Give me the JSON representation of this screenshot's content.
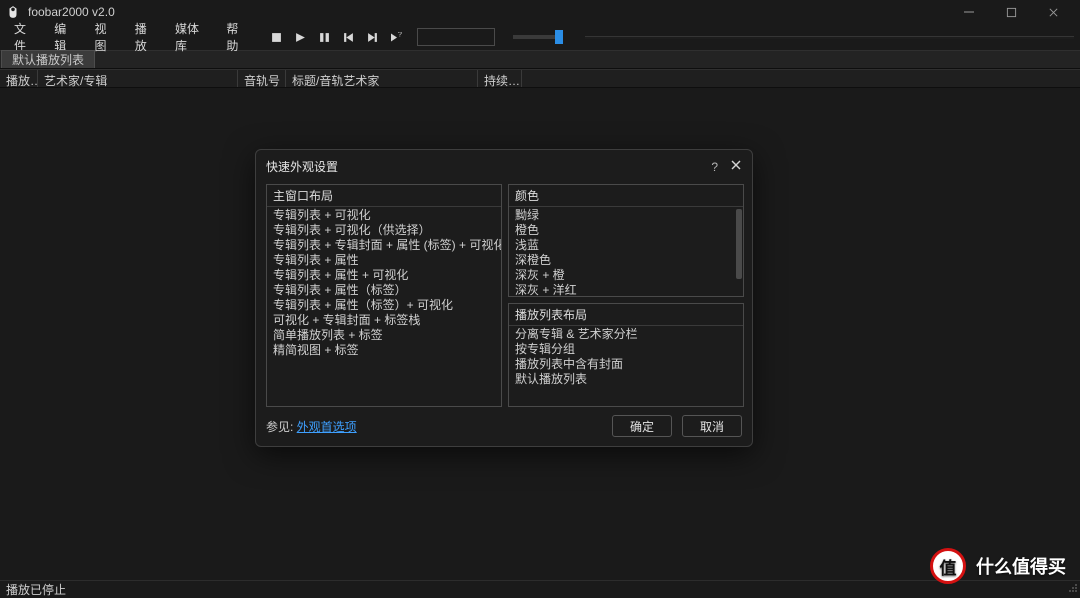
{
  "app": {
    "title": "foobar2000 v2.0"
  },
  "menu": {
    "items": [
      "文件",
      "编辑",
      "视图",
      "播放",
      "媒体库",
      "帮助"
    ]
  },
  "playlist": {
    "tab": "默认播放列表",
    "columns": {
      "c0": "播放…",
      "c1": "艺术家/专辑",
      "c2": "音轨号",
      "c3": "标题/音轨艺术家",
      "c4": "持续…"
    }
  },
  "status": {
    "text": "播放已停止"
  },
  "dialog": {
    "title": "快速外观设置",
    "help_symbol": "?",
    "panels": {
      "main_layout": {
        "header": "主窗口布局",
        "items": [
          "专辑列表 + 可视化",
          "专辑列表 + 可视化（供选择）",
          "专辑列表 + 专辑封面 + 属性 (标签) + 可视化 + 歌词",
          "专辑列表 + 属性",
          "专辑列表 + 属性 + 可视化",
          "专辑列表 + 属性（标签）",
          "专辑列表 + 属性（标签）+ 可视化",
          "可视化 + 专辑封面 + 标签栈",
          "简单播放列表 + 标签",
          "精简视图 + 标签"
        ]
      },
      "colors": {
        "header": "颜色",
        "items": [
          "黝绿",
          "橙色",
          "浅蓝",
          "深橙色",
          "深灰 + 橙",
          "深灰 + 洋红"
        ]
      },
      "playlist_layout": {
        "header": "播放列表布局",
        "items": [
          "分离专辑 & 艺术家分栏",
          "按专辑分组",
          "播放列表中含有封面",
          "默认播放列表"
        ]
      }
    },
    "footer": {
      "hint_prefix": "参见: ",
      "hint_link": "外观首选项",
      "ok": "确定",
      "cancel": "取消"
    }
  },
  "watermark": {
    "badge_char": "值",
    "text": "什么值得买"
  }
}
